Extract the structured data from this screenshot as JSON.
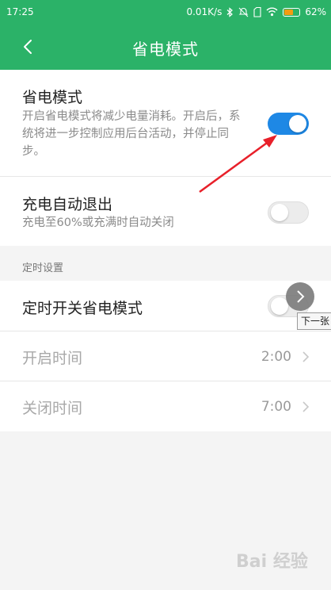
{
  "status_bar": {
    "time": "17:25",
    "network_speed": "0.01K/s",
    "battery": "62%",
    "battery_level": 0.62,
    "icons": [
      "bluetooth-icon",
      "mute-icon",
      "wifi-icon",
      "battery-icon"
    ]
  },
  "header": {
    "title": "省电模式",
    "back_icon": "chevron-left-icon",
    "background": "#2bb268"
  },
  "power_saving": {
    "title": "省电模式",
    "description": "开启省电模式将减少电量消耗。开启后，系统将进一步控制应用后台活动，并停止同步。",
    "enabled": true,
    "toggle_color": "#1e88e5"
  },
  "charge_exit": {
    "title": "充电自动退出",
    "description": "充电至60%或充满时自动关闭",
    "enabled": false
  },
  "schedule": {
    "section_label": "定时设置",
    "toggle_title": "定时开关省电模式",
    "enabled": false,
    "start_time_label": "开启时间",
    "start_time": "2:00",
    "end_time_label": "关闭时间",
    "end_time": "7:00"
  },
  "overlay": {
    "next_tooltip": "下一张",
    "watermark": "Bai 经验"
  }
}
